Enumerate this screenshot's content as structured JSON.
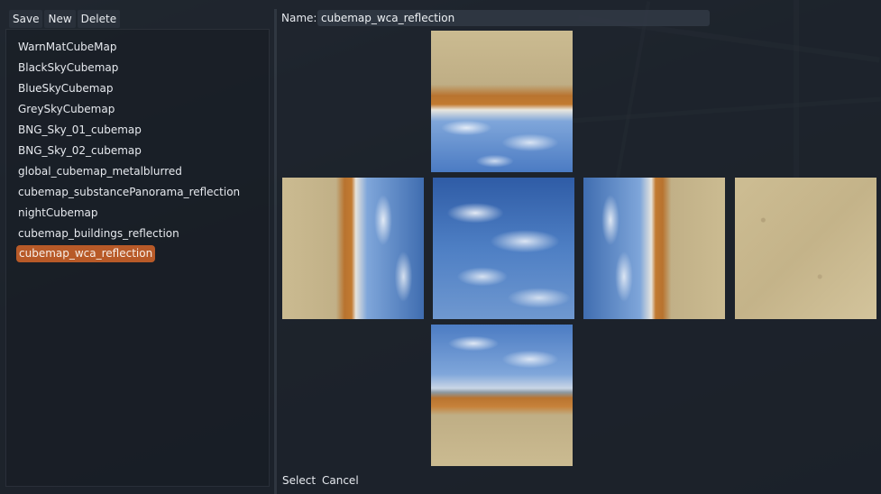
{
  "toolbar": {
    "save_label": "Save",
    "new_label": "New",
    "delete_label": "Delete"
  },
  "cubemaps": [
    {
      "label": "WarnMatCubeMap",
      "selected": false
    },
    {
      "label": "BlackSkyCubemap",
      "selected": false
    },
    {
      "label": "BlueSkyCubemap",
      "selected": false
    },
    {
      "label": "GreySkyCubemap",
      "selected": false
    },
    {
      "label": "BNG_Sky_01_cubemap",
      "selected": false
    },
    {
      "label": "BNG_Sky_02_cubemap",
      "selected": false
    },
    {
      "label": "global_cubemap_metalblurred",
      "selected": false
    },
    {
      "label": "cubemap_substancePanorama_reflection",
      "selected": false
    },
    {
      "label": "nightCubemap",
      "selected": false
    },
    {
      "label": "cubemap_buildings_reflection",
      "selected": false
    },
    {
      "label": "cubemap_wca_reflection",
      "selected": true
    }
  ],
  "editor": {
    "name_label": "Name:",
    "name_value": "cubemap_wca_reflection"
  },
  "actions": {
    "select_label": "Select",
    "cancel_label": "Cancel"
  },
  "colors": {
    "selection": "#b85a28",
    "panel_bg": "#1c222b"
  }
}
